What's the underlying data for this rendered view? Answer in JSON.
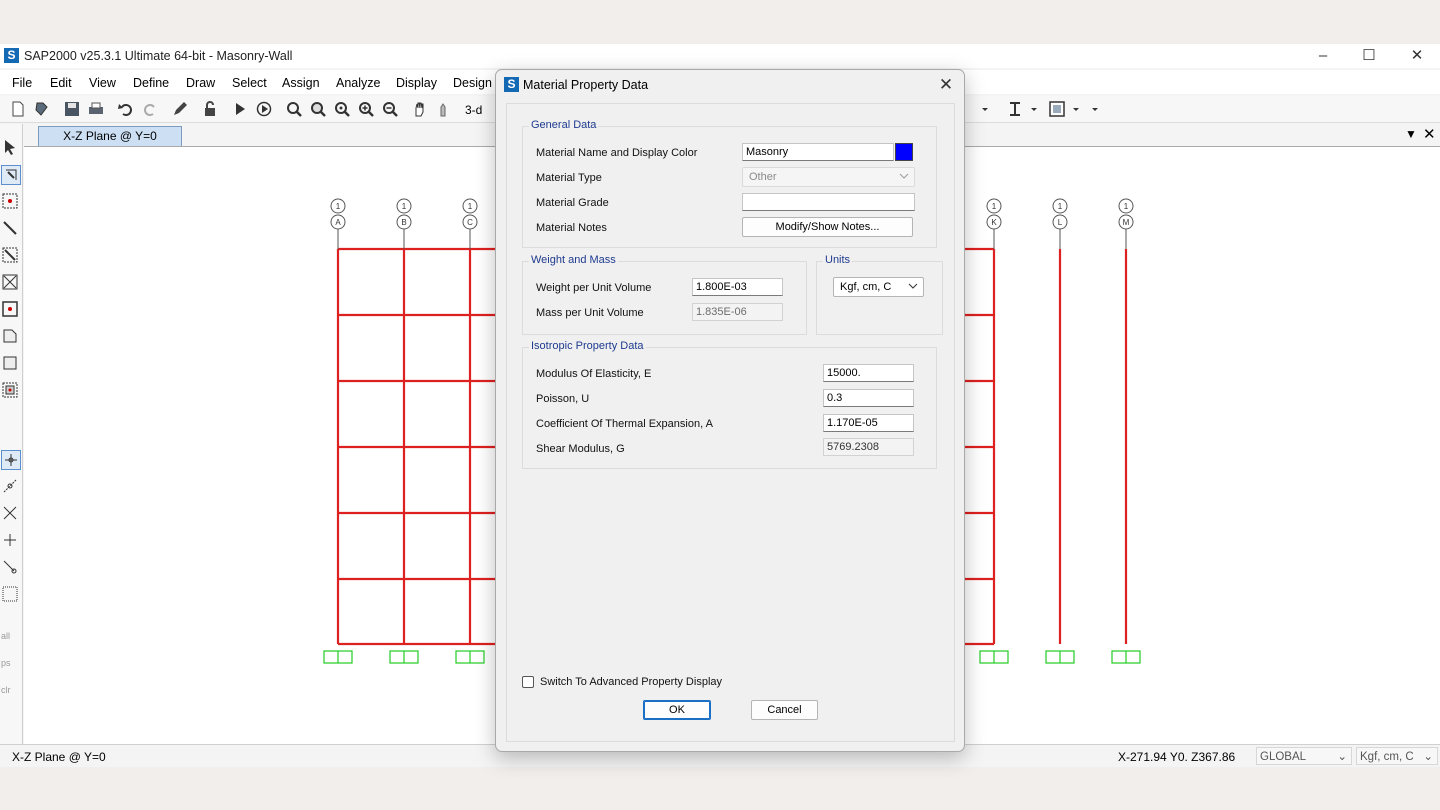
{
  "app": {
    "title": "SAP2000 v25.3.1 Ultimate 64-bit - Masonry-Wall",
    "logo_letter": "S"
  },
  "menu": [
    "File",
    "Edit",
    "View",
    "Define",
    "Draw",
    "Select",
    "Assign",
    "Analyze",
    "Display",
    "Design"
  ],
  "toolbar": {
    "view_3d": "3-d"
  },
  "view_tab": {
    "label": "X-Z Plane @ Y=0"
  },
  "grid_bubbles": {
    "top": [
      "1",
      "1",
      "1",
      "1",
      "1",
      "1"
    ],
    "letters": [
      "A",
      "B",
      "C",
      "K",
      "L",
      "M"
    ]
  },
  "colors": {
    "frame": "#dd2020",
    "support": "#22cc22",
    "material_color": "#0000ff",
    "accent": "#1469b5"
  },
  "left_toolbar_labels": [
    "all",
    "ps",
    "clr"
  ],
  "dialog": {
    "title": "Material Property Data",
    "logo_letter": "S",
    "general": {
      "title": "General Data",
      "name_label": "Material Name and Display Color",
      "name_value": "Masonry",
      "type_label": "Material Type",
      "type_value": "Other",
      "grade_label": "Material Grade",
      "grade_value": "",
      "notes_label": "Material Notes",
      "notes_button": "Modify/Show Notes..."
    },
    "weight": {
      "title": "Weight and Mass",
      "weight_label": "Weight per Unit Volume",
      "weight_value": "1.800E-03",
      "mass_label": "Mass per Unit Volume",
      "mass_value": "1.835E-06"
    },
    "units": {
      "title": "Units",
      "value": "Kgf, cm, C"
    },
    "isotropic": {
      "title": "Isotropic Property Data",
      "e_label": "Modulus Of Elasticity,  E",
      "e_value": "15000.",
      "u_label": "Poisson,  U",
      "u_value": "0.3",
      "a_label": "Coefficient Of Thermal Expansion,  A",
      "a_value": "1.170E-05",
      "g_label": "Shear Modulus,  G",
      "g_value": "5769.2308"
    },
    "advanced_label": "Switch To Advanced Property Display",
    "advanced_checked": false,
    "ok": "OK",
    "cancel": "Cancel"
  },
  "status": {
    "view": "X-Z Plane @ Y=0",
    "coords": "X-271.94  Y0.  Z367.86",
    "coord_system": "GLOBAL",
    "units": "Kgf, cm, C"
  }
}
